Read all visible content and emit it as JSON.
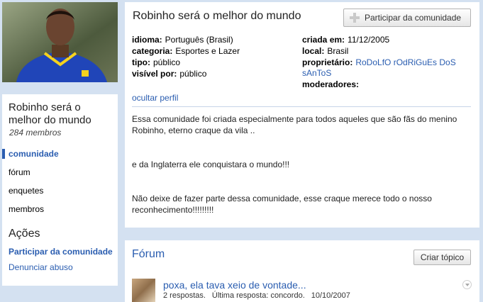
{
  "community": {
    "name": "Robinho será o melhor do mundo",
    "members": "284 membros",
    "join_label": "Participar da comunidade",
    "hide_profile": "ocultar perfil"
  },
  "sidebar": {
    "nav": [
      "comunidade",
      "fórum",
      "enquetes",
      "membros"
    ],
    "actions_title": "Ações",
    "actions": [
      "Participar da comunidade",
      "Denunciar abuso"
    ]
  },
  "info": {
    "idioma": {
      "label": "idioma:",
      "value": "Português (Brasil)"
    },
    "categoria": {
      "label": "categoria:",
      "value": "Esportes e Lazer"
    },
    "tipo": {
      "label": "tipo:",
      "value": "público"
    },
    "visivel": {
      "label": "visível por:",
      "value": "público"
    },
    "criada": {
      "label": "criada em:",
      "value": "11/12/2005"
    },
    "local": {
      "label": "local:",
      "value": "Brasil"
    },
    "proprietario": {
      "label": "proprietário:",
      "value": "RoDoLfO rOdRiGuEs DoS sAnToS"
    },
    "moderadores": {
      "label": "moderadores:",
      "value": ""
    }
  },
  "description": [
    "Essa comunidade foi criada especialmente para todos aqueles que são fãs do menino Robinho, eterno craque da vila ..",
    "",
    "",
    "e da Inglaterra ele conquistara o mundo!!!",
    "",
    "",
    "Não deixe de fazer parte dessa comunidade, esse craque merece todo o nosso reconhecimento!!!!!!!!!"
  ],
  "forum": {
    "title": "Fórum",
    "create_label": "Criar tópico",
    "topic": {
      "title": "poxa, ela tava xeio de vontade...",
      "replies": "2 respostas.",
      "last_reply": "Última resposta: concordo.",
      "date": "10/10/2007"
    }
  },
  "colors": {
    "link": "#2a5db0",
    "background": "#d4e1f1"
  }
}
